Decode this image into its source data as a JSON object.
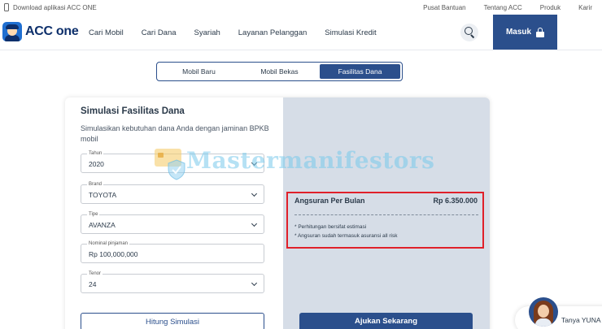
{
  "topbar": {
    "download_text": "Download aplikasi ACC ONE",
    "links": [
      "Pusat Bantuan",
      "Tentang ACC",
      "Produk",
      "Karir"
    ]
  },
  "nav": {
    "logo_text": "ACC one",
    "menu": [
      "Cari Mobil",
      "Cari Dana",
      "Syariah",
      "Layanan Pelanggan",
      "Simulasi Kredit"
    ],
    "login_label": "Masuk",
    "icons": {
      "search": "search-icon",
      "lock": "lock-icon"
    }
  },
  "tabs": [
    {
      "label": "Mobil Baru",
      "active": false
    },
    {
      "label": "Mobil Bekas",
      "active": false
    },
    {
      "label": "Fasilitas Dana",
      "active": true
    }
  ],
  "form": {
    "title": "Simulasi Fasilitas Dana",
    "description": "Simulasikan kebutuhan dana Anda dengan jaminan BPKB mobil",
    "fields": {
      "tahun": {
        "label": "Tahun",
        "value": "2020"
      },
      "brand": {
        "label": "Brand",
        "value": "TOYOTA"
      },
      "tipe": {
        "label": "Tipe",
        "value": "AVANZA"
      },
      "nominal": {
        "label": "Nominal pinjaman",
        "value": "Rp 100,000,000"
      },
      "tenor": {
        "label": "Tenor",
        "value": "24"
      }
    },
    "submit_label": "Hitung Simulasi"
  },
  "result": {
    "label": "Angsuran Per Bulan",
    "amount": "Rp 6.350.000",
    "notes": [
      "* Perhitungan bersifat estimasi",
      "* Angsuran sudah termasuk asuransi all risk"
    ],
    "apply_label": "Ajukan Sekarang"
  },
  "watermark": {
    "text": "Mastermanifestors"
  },
  "chat": {
    "label": "Tanya YUNA"
  },
  "colors": {
    "primary": "#2b4f8c",
    "panel": "#d6dde7",
    "highlight_border": "#e0202a"
  }
}
